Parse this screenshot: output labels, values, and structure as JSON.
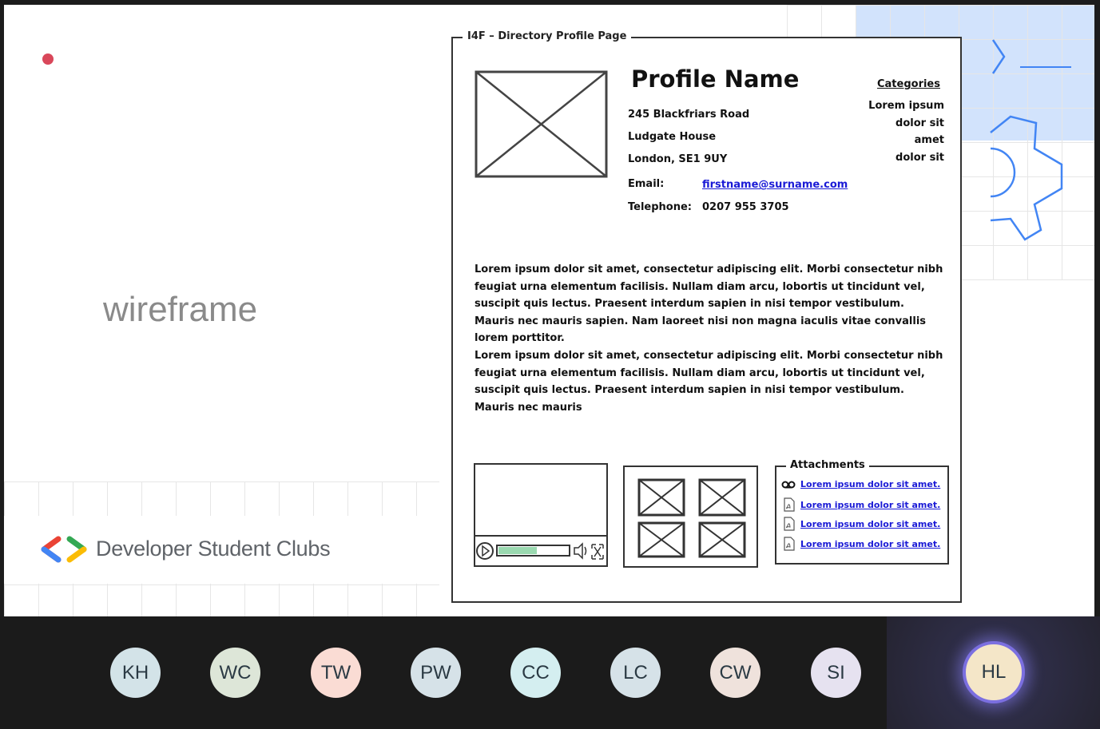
{
  "slide": {
    "label": "wireframe",
    "brand": "Developer Student Clubs"
  },
  "wireframe": {
    "title": "I4F – Directory Profile Page",
    "profile_name": "Profile Name",
    "address": [
      "245 Blackfriars Road",
      "Ludgate House",
      "London, SE1 9UY"
    ],
    "email_label": "Email:",
    "email_value": "firstname@surname.com",
    "phone_label": "Telephone:",
    "phone_value": "0207 955 3705",
    "categories_heading": "Categories",
    "categories": [
      "Lorem ipsum",
      "dolor sit",
      "amet",
      "dolor sit"
    ],
    "paragraph_1": "Lorem ipsum dolor sit amet, consectetur adipiscing elit. Morbi consectetur nibh feugiat urna elementum facilisis. Nullam diam arcu, lobortis ut tincidunt vel, suscipit quis lectus. Praesent interdum sapien in nisi tempor vestibulum. Mauris nec mauris sapien. Nam laoreet nisi non magna iaculis vitae convallis lorem porttitor.",
    "paragraph_2": "Lorem ipsum dolor sit amet, consectetur adipiscing elit. Morbi consectetur nibh feugiat urna elementum facilisis. Nullam diam arcu, lobortis ut tincidunt vel, suscipit quis lectus. Praesent interdum sapien in nisi tempor vestibulum. Mauris nec mauris",
    "attachments_title": "Attachments",
    "attachments": [
      {
        "icon": "voicemail-icon",
        "text": "Lorem ipsum dolor sit amet."
      },
      {
        "icon": "pdf-file-icon",
        "text": "Lorem ipsum dolor sit amet."
      },
      {
        "icon": "pdf-file-icon",
        "text": "Lorem ipsum dolor sit amet."
      },
      {
        "icon": "pdf-file-icon",
        "text": "Lorem ipsum dolor sit amet."
      }
    ],
    "video_progress": 0.55
  },
  "participants": [
    {
      "initials": "KH",
      "color": "#d3e3e8"
    },
    {
      "initials": "WC",
      "color": "#dde6d8"
    },
    {
      "initials": "TW",
      "color": "#fadcd4"
    },
    {
      "initials": "PW",
      "color": "#d6e2e8"
    },
    {
      "initials": "CC",
      "color": "#d4eef0"
    },
    {
      "initials": "LC",
      "color": "#d6e2e8"
    },
    {
      "initials": "CW",
      "color": "#efe2dc"
    },
    {
      "initials": "SI",
      "color": "#e6e2f0"
    }
  ],
  "active_speaker": {
    "initials": "HL",
    "color": "#f4e6c8"
  },
  "colors": {
    "dot": "#d9475a",
    "link": "#1a1ad6",
    "speaker_ring": "#7b6fe0"
  }
}
